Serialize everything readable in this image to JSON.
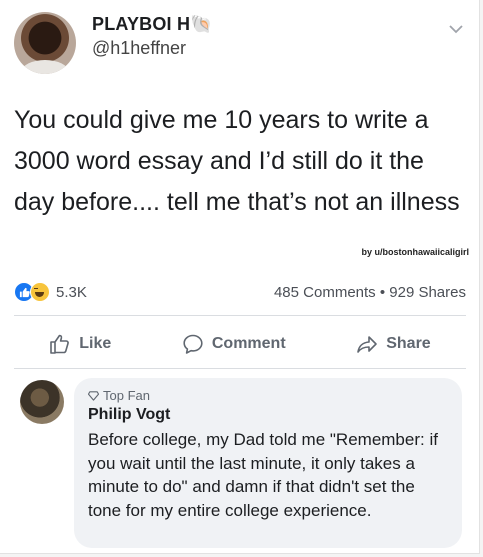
{
  "post": {
    "author_name": "PLAYBOI H🐚",
    "author_handle": "@h1heffner",
    "text": "You could give me 10 years to write a 3000 word essay and I’d still do it the day before.... tell me that’s not an illness",
    "watermark": "by u/bostonhawaiicaligirl"
  },
  "stats": {
    "reaction_count": "5.3K",
    "comments_shares": "485 Comments • 929 Shares"
  },
  "actions": {
    "like_label": "Like",
    "comment_label": "Comment",
    "share_label": "Share"
  },
  "comment": {
    "badge": "Top Fan",
    "author": "Philip Vogt",
    "text": "Before college, my Dad told me \"Remember: if you wait until the last minute, it only takes a minute to do\" and damn if that didn't set the tone for my entire college experience."
  },
  "colors": {
    "like_blue": "#1877f2",
    "haha_yellow": "#f7c43c",
    "secondary_text": "#606770"
  },
  "icons": [
    "chevron-down-icon",
    "like-reaction-icon",
    "haha-reaction-icon",
    "thumbs-up-icon",
    "comment-bubble-icon",
    "share-arrow-icon",
    "top-fan-badge-icon"
  ]
}
